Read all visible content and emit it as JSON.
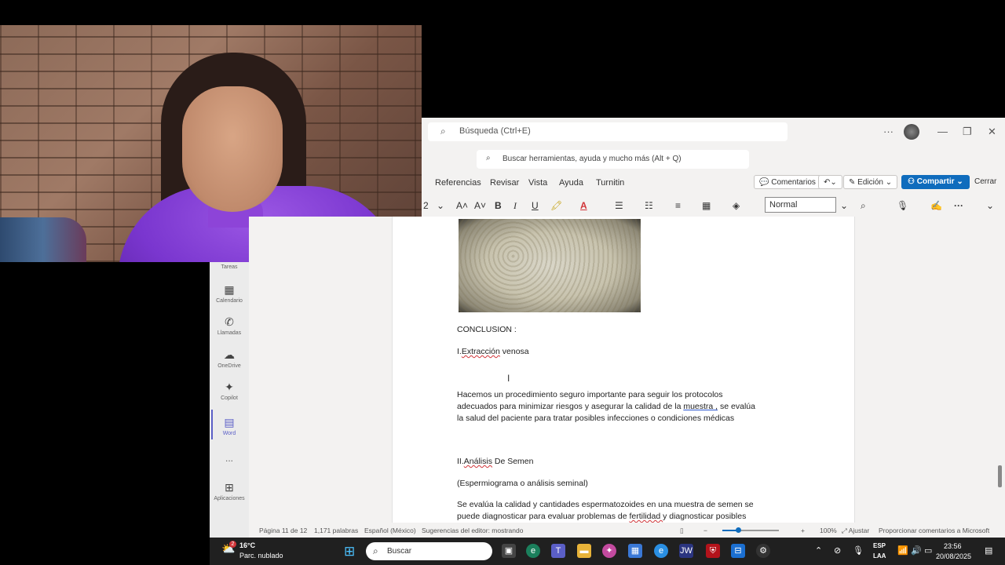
{
  "word": {
    "top_search_placeholder": "Búsqueda (Ctrl+E)",
    "tell_me_placeholder": "Buscar herramientas, ayuda y mucho más (Alt + Q)",
    "tabs": [
      "Referencias",
      "Revisar",
      "Vista",
      "Ayuda",
      "Turnitin"
    ],
    "comments_label": "Comentarios",
    "edit_mode_label": "Edición",
    "share_label": "Compartir",
    "close_label": "Cerrar",
    "font_size": "2",
    "style": "Normal"
  },
  "document": {
    "heading": "CONCLUSION :",
    "item1_prefix": "I.",
    "item1_word": "Extracción",
    "item1_rest": " venosa",
    "para1_line1": "Hacemos un procedimiento seguro importante para seguir los protocolos",
    "para1_line2_a": "adecuados para minimizar riesgos y asegurar la calidad de la ",
    "para1_link": "muestra ,",
    "para1_line2_b": " se evalúa",
    "para1_line3": "la salud del paciente para tratar posibles infecciones o condiciones médicas",
    "item2_prefix": "II.",
    "item2_word": "Análisis",
    "item2_rest": " De Semen",
    "subtitle": "(Espermiograma o análisis seminal)",
    "para2_line1": "Se evalúa la calidad y cantidades espermatozoides en una muestra de semen se",
    "para2_line2_a": "puede diagnosticar para evaluar problemas de ",
    "para2_link": "fertilidad ",
    "para2_line2_b": "y diagnosticar posibles"
  },
  "teams_sidebar": [
    {
      "label": "Tareas",
      "icon": "tasks-icon"
    },
    {
      "label": "Calendario",
      "icon": "calendar-icon"
    },
    {
      "label": "Llamadas",
      "icon": "phone-icon"
    },
    {
      "label": "OneDrive",
      "icon": "cloud-icon"
    },
    {
      "label": "Copilot",
      "icon": "copilot-icon"
    },
    {
      "label": "Word",
      "icon": "word-icon"
    },
    {
      "label": "...",
      "icon": "more-icon"
    },
    {
      "label": "Aplicaciones",
      "icon": "add-apps-icon"
    }
  ],
  "status_bar": {
    "page": "Página 11 de 12",
    "words": "1,171 palabras",
    "language": "Español (México)",
    "editor": "Sugerencias del editor: mostrando",
    "zoom": "100%",
    "fit": "Ajustar",
    "feedback": "Proporcionar comentarios a Microsoft"
  },
  "taskbar": {
    "temperature": "16°C",
    "weather": "Parc. nublado",
    "weather_badge": "2",
    "search_label": "Buscar",
    "lang1": "ESP",
    "lang2": "LAA",
    "time": "23:56",
    "date": "20/08/2025"
  },
  "colors": {
    "share_button": "#0f6cbd",
    "teams_accent": "#5b5fc7",
    "taskbar": "#202020"
  }
}
